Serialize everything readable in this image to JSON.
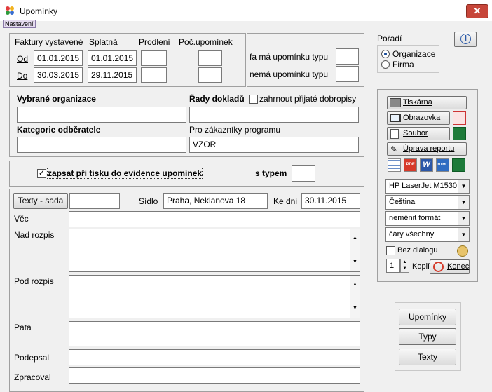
{
  "window": {
    "title": "Upomínky",
    "close_glyph": "✕"
  },
  "menu": {
    "settings": "Nastavení"
  },
  "dates": {
    "header_invoices": "Faktury vystavené",
    "header_due": "Splatná",
    "header_delay": "Prodlení",
    "header_count": "Poč.upomínek",
    "from_label": "Od",
    "to_label": "Do",
    "invoice_from": "01.01.2015",
    "invoice_to": "30.03.2015",
    "due_from": "01.01.2015",
    "due_to": "29.11.2015"
  },
  "reminder_type": {
    "has_label": "fa má upomínku typu",
    "hasnot_label": "nemá upomínku typu"
  },
  "order": {
    "title": "Pořadí",
    "opt_org": "Organizace",
    "opt_firm": "Firma"
  },
  "orgs": {
    "selected_label": "Vybrané organizace",
    "series_label": "Řady dokladů",
    "include_credit_label": "zahrnout přijaté dobropisy",
    "category_label": "Kategorie odběratele",
    "for_program_label": "Pro zákazníky programu",
    "program_value": "VZOR"
  },
  "record": {
    "checkbox_label": "zapsat při tisku do evidence upomínek",
    "with_type_label": "s typem",
    "check_glyph": "✓"
  },
  "texts": {
    "set_button": "Texty - sada",
    "sidlo_label": "Sídlo",
    "sidlo_value": "Praha, Neklanova 18",
    "ke_dni_label": "Ke dni",
    "ke_dni_value": "30.11.2015",
    "vec_label": "Věc",
    "nad_label": "Nad rozpis",
    "pod_label": "Pod rozpis",
    "pata_label": "Pata",
    "podepsal_label": "Podepsal",
    "zpracoval_label": "Zpracoval"
  },
  "right": {
    "printer_btn": "Tiskárna",
    "screen_btn": "Obrazovka",
    "file_btn": "Soubor",
    "edit_report_btn": "Úprava reportu",
    "format_icons": {
      "pdf": "PDF",
      "word": "W",
      "html": "HTML"
    },
    "printer_select": "HP LaserJet M1530",
    "language_select": "Čeština",
    "format_select": "neměnit formát",
    "lines_select": "čáry všechny",
    "no_dialog_label": "Bez dialogu",
    "copies_value": "1",
    "copies_label": "Kopií",
    "end_btn": "Konec",
    "dropdown_glyph": "▼"
  },
  "bottom": {
    "reminders_btn": "Upomínky",
    "types_btn": "Typy",
    "texts_btn": "Texty"
  },
  "info_glyph": "i"
}
